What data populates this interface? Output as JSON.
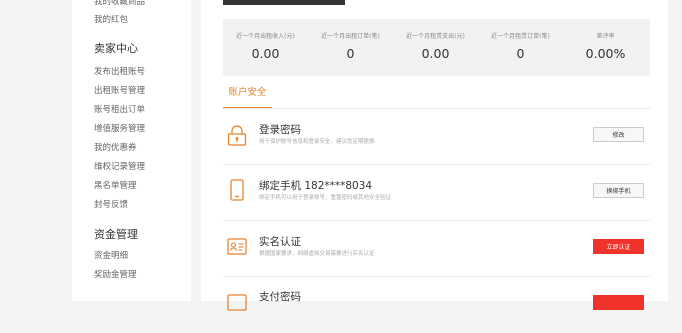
{
  "sidebar": {
    "top_links": [
      "我的收藏商品",
      "我的红包"
    ],
    "seller_center": {
      "title": "卖家中心",
      "items": [
        "发布出租账号",
        "出租账号管理",
        "账号租出订单",
        "增值服务管理",
        "我的优惠券",
        "维权记录管理",
        "黑名单管理",
        "封号反馈"
      ]
    },
    "funds": {
      "title": "资金管理",
      "items": [
        "资金明细",
        "奖励金管理"
      ]
    }
  },
  "stats": [
    {
      "label": "近一个月出租收入(元)",
      "value": "0.00"
    },
    {
      "label": "近一个月出租订单(笔)",
      "value": "0"
    },
    {
      "label": "近一个月租赁支出(元)",
      "value": "0.00"
    },
    {
      "label": "近一个月租赁订单(笔)",
      "value": "0"
    },
    {
      "label": "差评率",
      "value": "0.00%"
    }
  ],
  "tab": {
    "label": "账户安全"
  },
  "security_items": [
    {
      "icon": "lock-icon",
      "title": "登录密码",
      "desc": "用于保护账号信息和登录安全，建议您定期更换",
      "button": "修改",
      "button_style": "plain"
    },
    {
      "icon": "phone-icon",
      "title": "绑定手机 182****8034",
      "desc": "绑定手机可以用于登录账号，重置密码或其他安全验证",
      "button": "换绑手机",
      "button_style": "plain"
    },
    {
      "icon": "id-card-icon",
      "title": "实名认证",
      "desc": "根据国家要求，网络虚拟交易需要进行实名认证",
      "button": "立即认证",
      "button_style": "red"
    },
    {
      "icon": "payment-password-icon",
      "title": "支付密码",
      "desc": "",
      "button": "",
      "button_style": "red"
    }
  ],
  "colors": {
    "accent": "#e6852c",
    "danger": "#f0332a",
    "stats_bg": "#f2f2f2",
    "page_bg": "#f4f4f4"
  }
}
